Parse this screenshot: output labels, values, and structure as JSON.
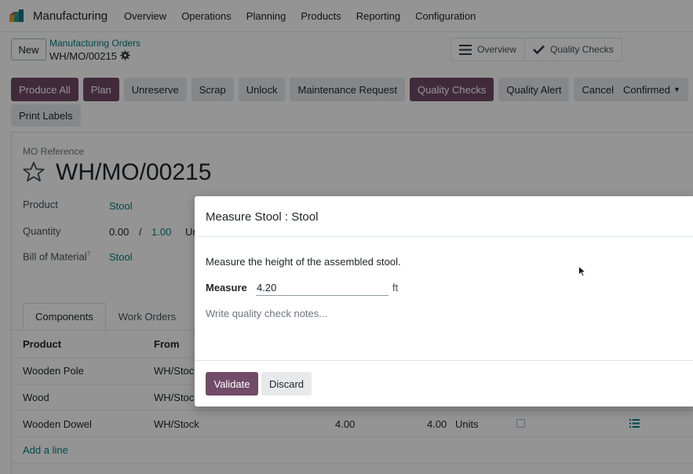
{
  "app": {
    "name": "Manufacturing"
  },
  "menu": [
    "Overview",
    "Operations",
    "Planning",
    "Products",
    "Reporting",
    "Configuration"
  ],
  "control_panel": {
    "new_label": "New",
    "breadcrumb_parent": "Manufacturing Orders",
    "breadcrumb_current": "WH/MO/00215",
    "smart_buttons": {
      "overview": "Overview",
      "quality_checks": "Quality Checks"
    }
  },
  "actions": {
    "produce_all": "Produce All",
    "plan": "Plan",
    "unreserve": "Unreserve",
    "scrap": "Scrap",
    "unlock": "Unlock",
    "maintenance_request": "Maintenance Request",
    "quality_checks": "Quality Checks",
    "quality_alert": "Quality Alert",
    "cancel": "Cancel",
    "print_labels": "Print Labels",
    "status": "Confirmed"
  },
  "form": {
    "mo_reference_label": "MO Reference",
    "mo_reference": "WH/MO/00215",
    "product_label": "Product",
    "product": "Stool",
    "quantity_label": "Quantity",
    "quantity_done": "0.00",
    "quantity_sep": "/",
    "quantity_total": "1.00",
    "quantity_unit_partial": "Ur",
    "bom_label": "Bill of Material",
    "bom_help": "?",
    "bom": "Stool"
  },
  "tabs": {
    "components": "Components",
    "work_orders": "Work Orders"
  },
  "table": {
    "headers": {
      "product": "Product",
      "from": "From"
    },
    "rows": [
      {
        "product": "Wooden Pole",
        "from": "WH/Stock"
      },
      {
        "product": "Wood",
        "from": "WH/Stock"
      },
      {
        "product": "Wooden Dowel",
        "from": "WH/Stock",
        "to_consume": "4.00",
        "quantity": "4.00",
        "unit": "Units"
      }
    ],
    "add_line": "Add a line"
  },
  "modal": {
    "title": "Measure Stool : Stool",
    "description": "Measure the height of the assembled stool.",
    "measure_label": "Measure",
    "measure_value": "4.20",
    "measure_unit": "ft",
    "notes_placeholder": "Write quality check notes...",
    "validate_label": "Validate",
    "discard_label": "Discard"
  },
  "colors": {
    "primary": "#714b67",
    "link": "#017e84",
    "backdrop": "rgba(0,0,0,0.42)"
  }
}
